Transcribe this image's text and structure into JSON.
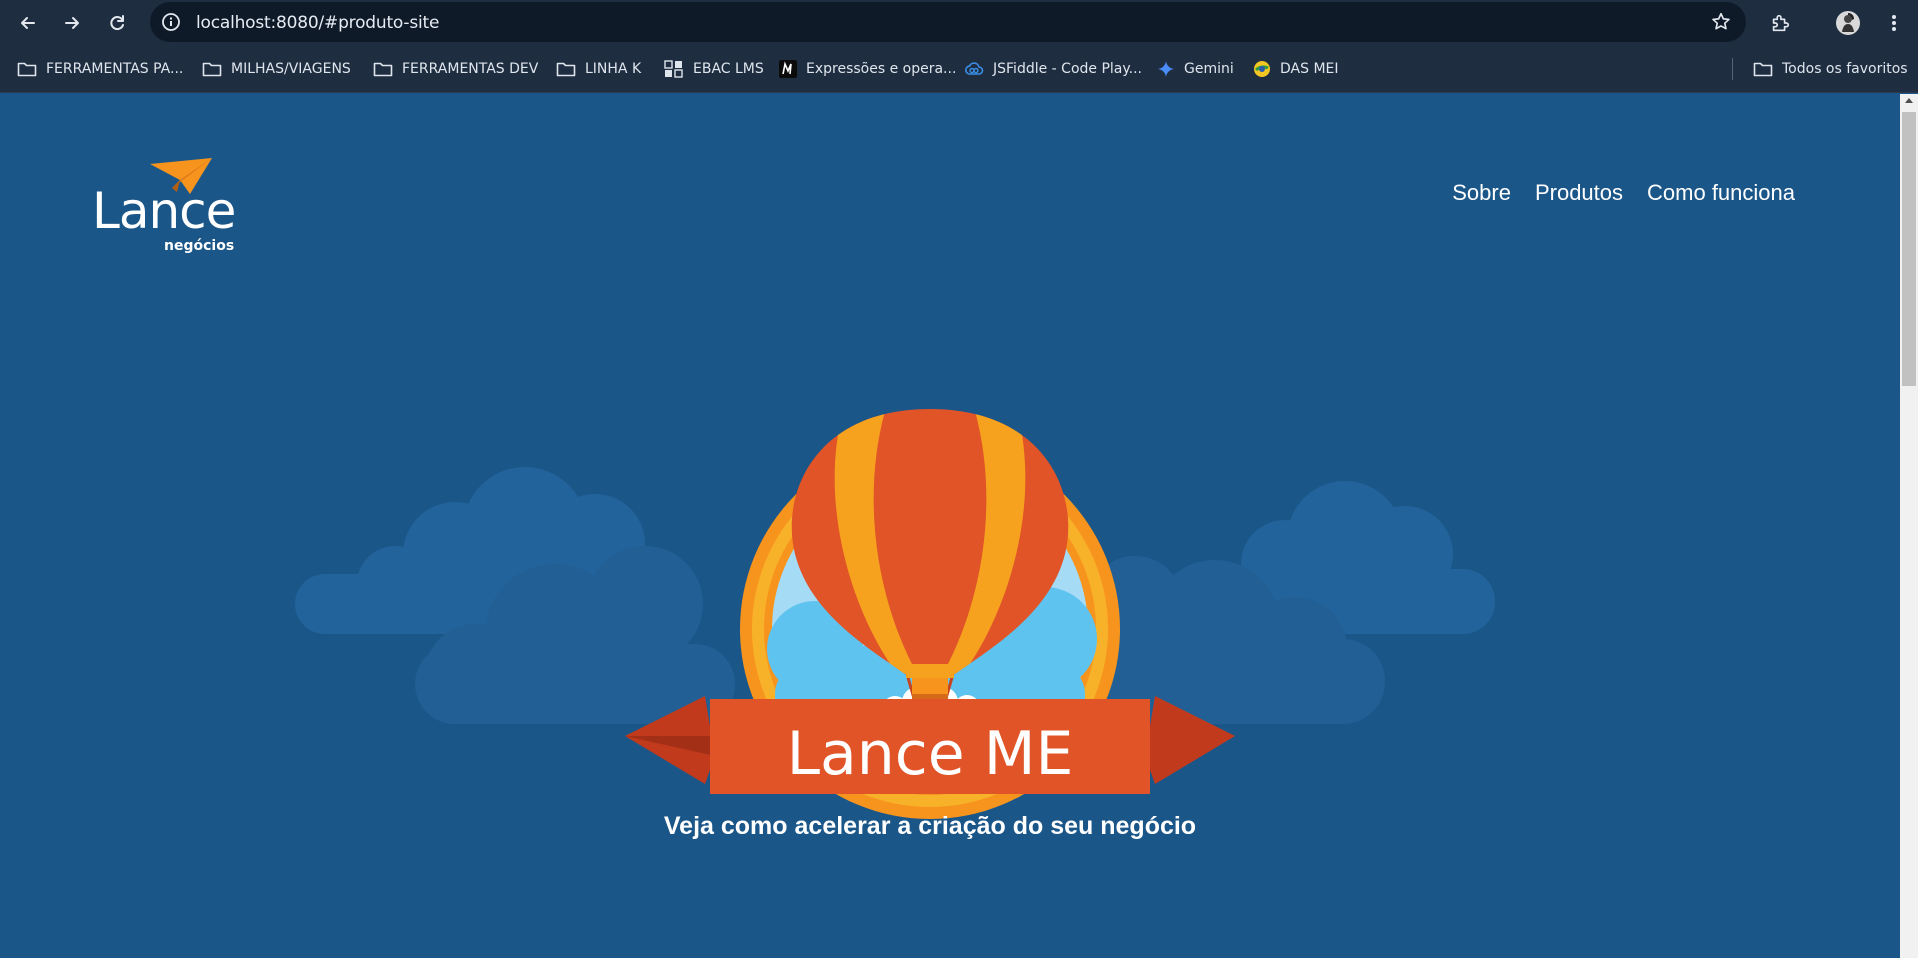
{
  "browser": {
    "url": "localhost:8080/#produto-site",
    "bookmarks": [
      {
        "label": "FERRAMENTAS PA...",
        "icon": "folder-icon"
      },
      {
        "label": "MILHAS/VIAGENS",
        "icon": "folder-icon"
      },
      {
        "label": "FERRAMENTAS DEV",
        "icon": "folder-icon"
      },
      {
        "label": "LINHA K",
        "icon": "folder-icon"
      },
      {
        "label": "EBAC LMS",
        "icon": "ebac-icon"
      },
      {
        "label": "Expressões e opera...",
        "icon": "m-icon"
      },
      {
        "label": "JSFiddle - Code Play...",
        "icon": "jsfiddle-icon"
      },
      {
        "label": "Gemini",
        "icon": "gemini-icon"
      },
      {
        "label": "DAS MEI",
        "icon": "das-icon"
      }
    ],
    "all_bookmarks_label": "Todos os favoritos"
  },
  "site": {
    "logo_word": "Lance",
    "logo_sub": "negócios",
    "nav": [
      "Sobre",
      "Produtos",
      "Como funciona"
    ],
    "hero_banner_text": "Lance ME",
    "tagline": "Veja como acelerar a criação do seu negócio"
  },
  "colors": {
    "page_bg": "#1b5689",
    "banner_red": "#e05427",
    "balloon_orange": "#f6a21f",
    "badge_ring": "#f7941d",
    "sky": "#5fc3ef",
    "chrome_bg": "#1f2d40"
  }
}
